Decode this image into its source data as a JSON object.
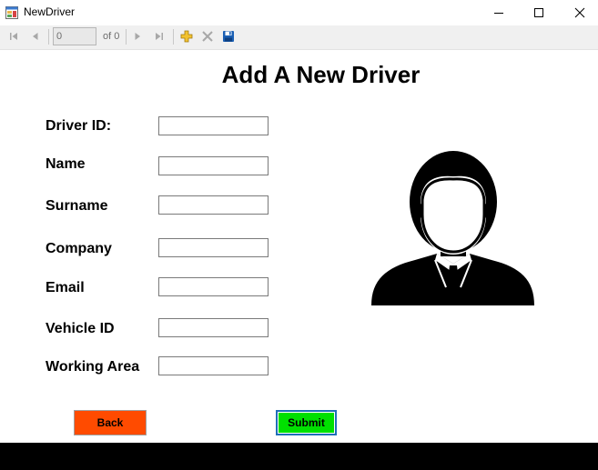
{
  "window": {
    "title": "NewDriver"
  },
  "navigator": {
    "position_value": "0",
    "count_label": "of 0"
  },
  "form": {
    "heading": "Add A New Driver",
    "fields": [
      {
        "label": "Driver ID:",
        "value": ""
      },
      {
        "label": "Name",
        "value": ""
      },
      {
        "label": "Surname",
        "value": ""
      },
      {
        "label": "Company",
        "value": ""
      },
      {
        "label": "Email",
        "value": ""
      },
      {
        "label": "Vehicle ID",
        "value": ""
      },
      {
        "label": "Working Area",
        "value": ""
      }
    ]
  },
  "buttons": {
    "back_label": "Back",
    "submit_label": "Submit"
  },
  "colors": {
    "back": "#ff4b00",
    "submit": "#00e000",
    "submit_border": "#1f6fb8"
  },
  "icons": [
    "app-form-icon",
    "minimize-icon",
    "maximize-icon",
    "close-icon",
    "move-first-icon",
    "move-previous-icon",
    "move-next-icon",
    "move-last-icon",
    "add-new-icon",
    "delete-icon",
    "save-icon",
    "driver-avatar-icon"
  ]
}
